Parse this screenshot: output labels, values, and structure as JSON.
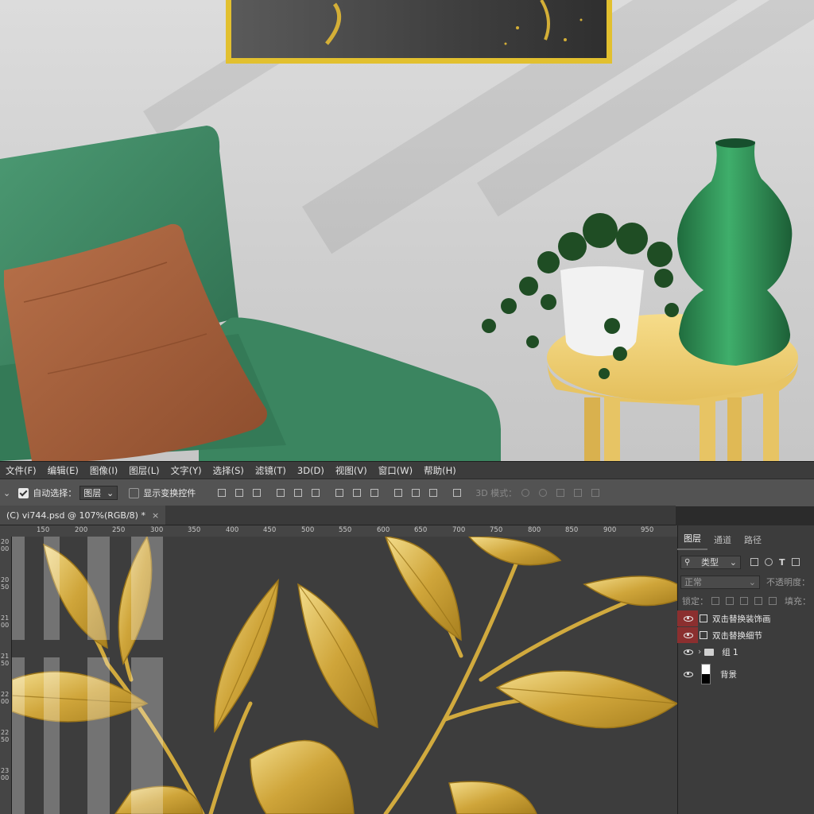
{
  "menu": {
    "items": [
      "文件(F)",
      "编辑(E)",
      "图像(I)",
      "图层(L)",
      "文字(Y)",
      "选择(S)",
      "滤镜(T)",
      "3D(D)",
      "视图(V)",
      "窗口(W)",
      "帮助(H)"
    ]
  },
  "options_bar": {
    "auto_select_label": "自动选择：",
    "auto_select_checked": true,
    "auto_select_target": "图层",
    "show_transform_label": "显示变换控件",
    "show_transform_checked": false,
    "mode_3d_label": "3D 模式："
  },
  "document": {
    "tab_title": "(C) vi744.psd @ 107%(RGB/8) *",
    "close_glyph": "×",
    "ruler_h": [
      "150",
      "200",
      "250",
      "300",
      "350",
      "400",
      "450",
      "500",
      "550",
      "600",
      "650",
      "700",
      "750",
      "800",
      "850",
      "900",
      "950"
    ],
    "ruler_v": [
      "2000",
      "2050",
      "2100",
      "2150",
      "2200",
      "2250",
      "2300"
    ]
  },
  "layers_panel": {
    "tabs": [
      "图层",
      "通道",
      "路径"
    ],
    "active_tab": "图层",
    "filter_label": "类型",
    "blend_mode": "正常",
    "opacity_label": "不透明度：",
    "lock_label": "锁定：",
    "fill_label": "填充：",
    "layers": [
      {
        "name": "双击替换装饰画",
        "type": "smart-object",
        "eye_highlight": true
      },
      {
        "name": "双击替换细节",
        "type": "smart-object",
        "eye_highlight": true
      },
      {
        "name": "组 1",
        "type": "group",
        "eye_highlight": false
      },
      {
        "name": "背景",
        "type": "background",
        "eye_highlight": false
      }
    ]
  },
  "colors": {
    "gold": "#d4af37",
    "frame_gold": "#e2c02f",
    "sofa_green": "#3f8a66",
    "pillow_brown": "#a9623d",
    "vase_green": "#2d8a52",
    "table_yellow": "#f0d27a",
    "layer_eye_highlight": "#8b2f2f"
  }
}
